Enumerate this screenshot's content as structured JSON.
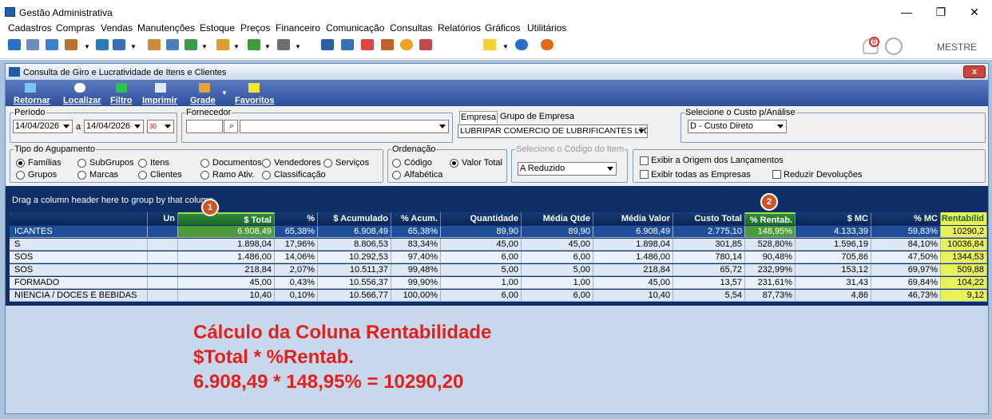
{
  "app": {
    "title": "Gestão Administrativa",
    "min": "—",
    "max": "❐",
    "close": "✕",
    "user": "MESTRE",
    "notif_count": "0"
  },
  "menu": [
    "Cadastros",
    "Compras",
    "Vendas",
    "Manutenções",
    "Estoque",
    "Preços",
    "Financeiro",
    "Comunicação",
    "Consultas",
    "Relatórios",
    "Gráficos",
    "Utilitários"
  ],
  "child": {
    "title": "Consulta de Giro e Lucratividade de Itens e Clientes",
    "close": "x"
  },
  "ribbon": [
    "Retornar",
    "Localizar",
    "Filtro",
    "Imprimir",
    "Grade",
    "Favoritos"
  ],
  "periodo": {
    "label": "Período",
    "from": "14/04/2026",
    "sep": "a",
    "to": "14/04/2026",
    "cal": "30"
  },
  "fornecedor": {
    "label": "Fornecedor",
    "code": "",
    "name": ""
  },
  "empresa": {
    "tab1": "Empresa",
    "tab2": "Grupo de Empresa",
    "value": "LUBRIPAR COMERCIO DE LUBRIFICANTES LTDA EPP"
  },
  "custo": {
    "label": "Selecione o Custo p/Análise",
    "value": "D - Custo Direto"
  },
  "agrup": {
    "label": "Tipo do Agupamento",
    "options": [
      "Famílias",
      "SubGrupos",
      "Itens",
      "Documentos",
      "Vendedores",
      "Serviços",
      "Grupos",
      "Marcas",
      "Clientes",
      "Ramo Ativ.",
      "Classificação"
    ],
    "selected": "Famílias"
  },
  "ordenacao": {
    "label": "Ordenação",
    "options": [
      "Código",
      "Valor Total",
      "Alfabética"
    ],
    "selected": "Valor Total"
  },
  "codigo_item": {
    "label": "Selecione o Código do Item",
    "value": "A Reduzido"
  },
  "opcoes": {
    "origem": "Exibir a Origem dos Lançamentos",
    "todas": "Exibir todas as Empresas",
    "reduzir": "Reduzir Devoluções"
  },
  "grid": {
    "hint": "Drag a column header here to group by that column",
    "columns": [
      "",
      "Un",
      "$ Total",
      "%",
      "$ Acumulado",
      "% Acum.",
      "Quantidade",
      "Média Qtde",
      "Média Valor",
      "Custo Total",
      "% Rentab.",
      "$ MC",
      "% MC",
      "Rentabilid"
    ],
    "rows": [
      [
        "ICANTES",
        "",
        "6.908,49",
        "65,38%",
        "6.908,49",
        "65,38%",
        "89,90",
        "89,90",
        "6.908,49",
        "2.775,10",
        "148,95%",
        "4.133,39",
        "59,83%",
        "10290,2"
      ],
      [
        "S",
        "",
        "1.898,04",
        "17,96%",
        "8.806,53",
        "83,34%",
        "45,00",
        "45,00",
        "1.898,04",
        "301,85",
        "528,80%",
        "1.596,19",
        "84,10%",
        "10036,84"
      ],
      [
        "SOS",
        "",
        "1.486,00",
        "14,06%",
        "10.292,53",
        "97,40%",
        "6,00",
        "6,00",
        "1.486,00",
        "780,14",
        "90,48%",
        "705,86",
        "47,50%",
        "1344,53"
      ],
      [
        "SOS",
        "",
        "218,84",
        "2,07%",
        "10.511,37",
        "99,48%",
        "5,00",
        "5,00",
        "218,84",
        "65,72",
        "232,99%",
        "153,12",
        "69,97%",
        "509,88"
      ],
      [
        "FORMADO",
        "",
        "45,00",
        "0,43%",
        "10.556,37",
        "99,90%",
        "1,00",
        "1,00",
        "45,00",
        "13,57",
        "231,61%",
        "31,43",
        "69,84%",
        "104,22"
      ],
      [
        "NIENCIA / DOCES E BEBIDAS",
        "",
        "10,40",
        "0,10%",
        "10.566,77",
        "100,00%",
        "6,00",
        "6,00",
        "10,40",
        "5,54",
        "87,73%",
        "4,86",
        "46,73%",
        "9,12"
      ]
    ]
  },
  "badges": [
    "1",
    "2"
  ],
  "annotation": [
    "Cálculo da Coluna Rentabilidade",
    "$Total * %Rentab.",
    "6.908,49 * 148,95% = 10290,20"
  ],
  "colors": {
    "accent": "#1f4e9b",
    "annotation": "#e3211c",
    "highlight": "#e8f05a"
  }
}
